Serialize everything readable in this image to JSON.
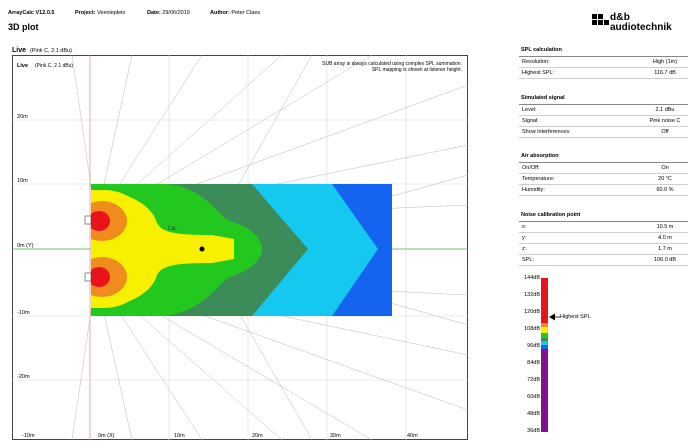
{
  "header": {
    "app": "ArrayCalc V12.0.5",
    "project_label": "Project:",
    "project": "Veenleplein",
    "date_label": "Date:",
    "date": "29/06/2019",
    "author_label": "Author:",
    "author": "Peter Claes"
  },
  "page_title": "3D plot",
  "logo": {
    "line1": "d&b",
    "line2": "audiotechnik"
  },
  "plot": {
    "title": "Live",
    "subtitle": "(Pink C, 2.1 dBu)",
    "inner_title": "Live",
    "inner_subtitle": "(Pink C, 2.1 dBu)",
    "note_line1": "SUB array is always calculated using complex SPL summation.",
    "note_line2": "SPL mapping is shown at listener height.",
    "cal_label": "Cal.",
    "y_ticks": [
      "20m",
      "10m",
      "0m (Y)",
      "-10m",
      "-20m"
    ],
    "x_ticks": [
      "-10m",
      "0m (X)",
      "10m",
      "20m",
      "30m",
      "40m"
    ]
  },
  "panels": {
    "spl_calc": {
      "title": "SPL calculation",
      "rows": [
        {
          "label": "Resolution:",
          "value": "High (1m)"
        },
        {
          "label": "Highest SPL:",
          "value": "116.7 dB"
        }
      ]
    },
    "sim_signal": {
      "title": "Simulated signal",
      "rows": [
        {
          "label": "Level:",
          "value": "2.1 dBu"
        },
        {
          "label": "Signal:",
          "value": "Pink noise C"
        },
        {
          "label": "Show interferences:",
          "value": "Off"
        }
      ]
    },
    "air": {
      "title": "Air absorption",
      "rows": [
        {
          "label": "On/Off:",
          "value": "On"
        },
        {
          "label": "Temperature:",
          "value": "20 °C"
        },
        {
          "label": "Humidity:",
          "value": "60.0 %"
        }
      ]
    },
    "noise_cal": {
      "title": "Noise calibration point",
      "rows": [
        {
          "label": "x:",
          "value": "10.5 m"
        },
        {
          "label": "y:",
          "value": "4.0 m"
        },
        {
          "label": "z:",
          "value": "1.7 m"
        },
        {
          "label": "SPL:",
          "value": "106.0 dB"
        }
      ]
    }
  },
  "legend": {
    "labels": [
      "144dB",
      "132dB",
      "120dB",
      "108dB",
      "96dB",
      "84dB",
      "72dB",
      "60dB",
      "48dB",
      "36dB"
    ],
    "highest_label": "Highest SPL",
    "colors": {
      "red": "#e8141c",
      "orange": "#f08c1e",
      "yellow": "#f7f000",
      "green": "#23c81e",
      "darkgreen": "#3c8c5a",
      "cyan": "#14c8f0",
      "blue": "#1464f0",
      "purple": "#7d148c"
    }
  }
}
